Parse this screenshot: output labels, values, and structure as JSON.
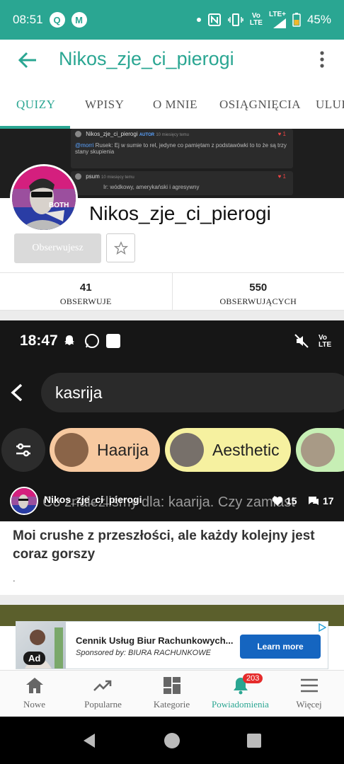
{
  "status_bar": {
    "time": "08:51",
    "network_volte": "Vo",
    "network_lte": "LTE",
    "lte_plus": "LTE+",
    "battery": "45%",
    "icons": [
      "q-app-icon",
      "motorola-icon",
      "dot-icon",
      "nfc-icon",
      "vibrate-icon",
      "volte-icon",
      "lte-signal-icon",
      "battery-icon"
    ]
  },
  "app_bar": {
    "title": "Nikos_zje_ci_pierogi"
  },
  "tabs": [
    {
      "label": "QUIZY",
      "active": true
    },
    {
      "label": "WPISY",
      "active": false
    },
    {
      "label": "O MNIE",
      "active": false
    },
    {
      "label": "OSIĄGNIĘCIA",
      "active": false
    },
    {
      "label": "ULUB",
      "active": false
    }
  ],
  "cover": {
    "comment1_user": "Nikos_zje_ci_pierogi",
    "comment1_badge": "AUTOR",
    "comment1_meta": "10 miesięcy temu",
    "comment1_text": "Rusek: Ej w sumie to rel, jedyne co pamiętam z podstawówki to to że są trzy stany skupienia",
    "comment1_mention": "@morri",
    "comment1_likes": "1",
    "comment2_user": "psum",
    "comment2_meta": "10 miesięcy temu",
    "comment2_text": "Ir: wódkowy, amerykański i agresywny",
    "comment2_likes": "1"
  },
  "profile": {
    "avatar_badge": "BOTH",
    "username": "Nikos_zje_ci_pierogi",
    "follow_label": "Obserwujesz",
    "following_count": "41",
    "following_label": "OBSERWUJE",
    "followers_count": "550",
    "followers_label": "OBSERWUJĄCYCH"
  },
  "post": {
    "image": {
      "time": "18:47",
      "search_query": "kasrija",
      "chips": [
        "Haarija",
        "Aesthetic"
      ],
      "overlay_text": "Co znaleźliśmy dla: kaarija. Czy zamiast"
    },
    "author": "Nikos_zje_ci_pierogi",
    "likes": "15",
    "comments": "17",
    "title": "Moi crushe z przeszłości, ale każdy kolejny jest coraz gorszy",
    "description": "."
  },
  "ad": {
    "badge": "Ad",
    "title": "Cennik Usług Biur Rachunkowych...",
    "sponsor": "Sponsored by: BIURA RACHUNKOWE",
    "cta": "Learn more"
  },
  "bottom_nav": [
    {
      "label": "Nowe",
      "icon": "home-icon"
    },
    {
      "label": "Popularne",
      "icon": "trending-icon"
    },
    {
      "label": "Kategorie",
      "icon": "grid-icon"
    },
    {
      "label": "Powiadomienia",
      "icon": "bell-icon",
      "badge": "203",
      "active": true
    },
    {
      "label": "Więcej",
      "icon": "menu-icon"
    }
  ],
  "colors": {
    "accent": "#2aa692",
    "status_bar": "#2aa692",
    "badge": "#e52b2b",
    "ad_button": "#1565c0"
  }
}
